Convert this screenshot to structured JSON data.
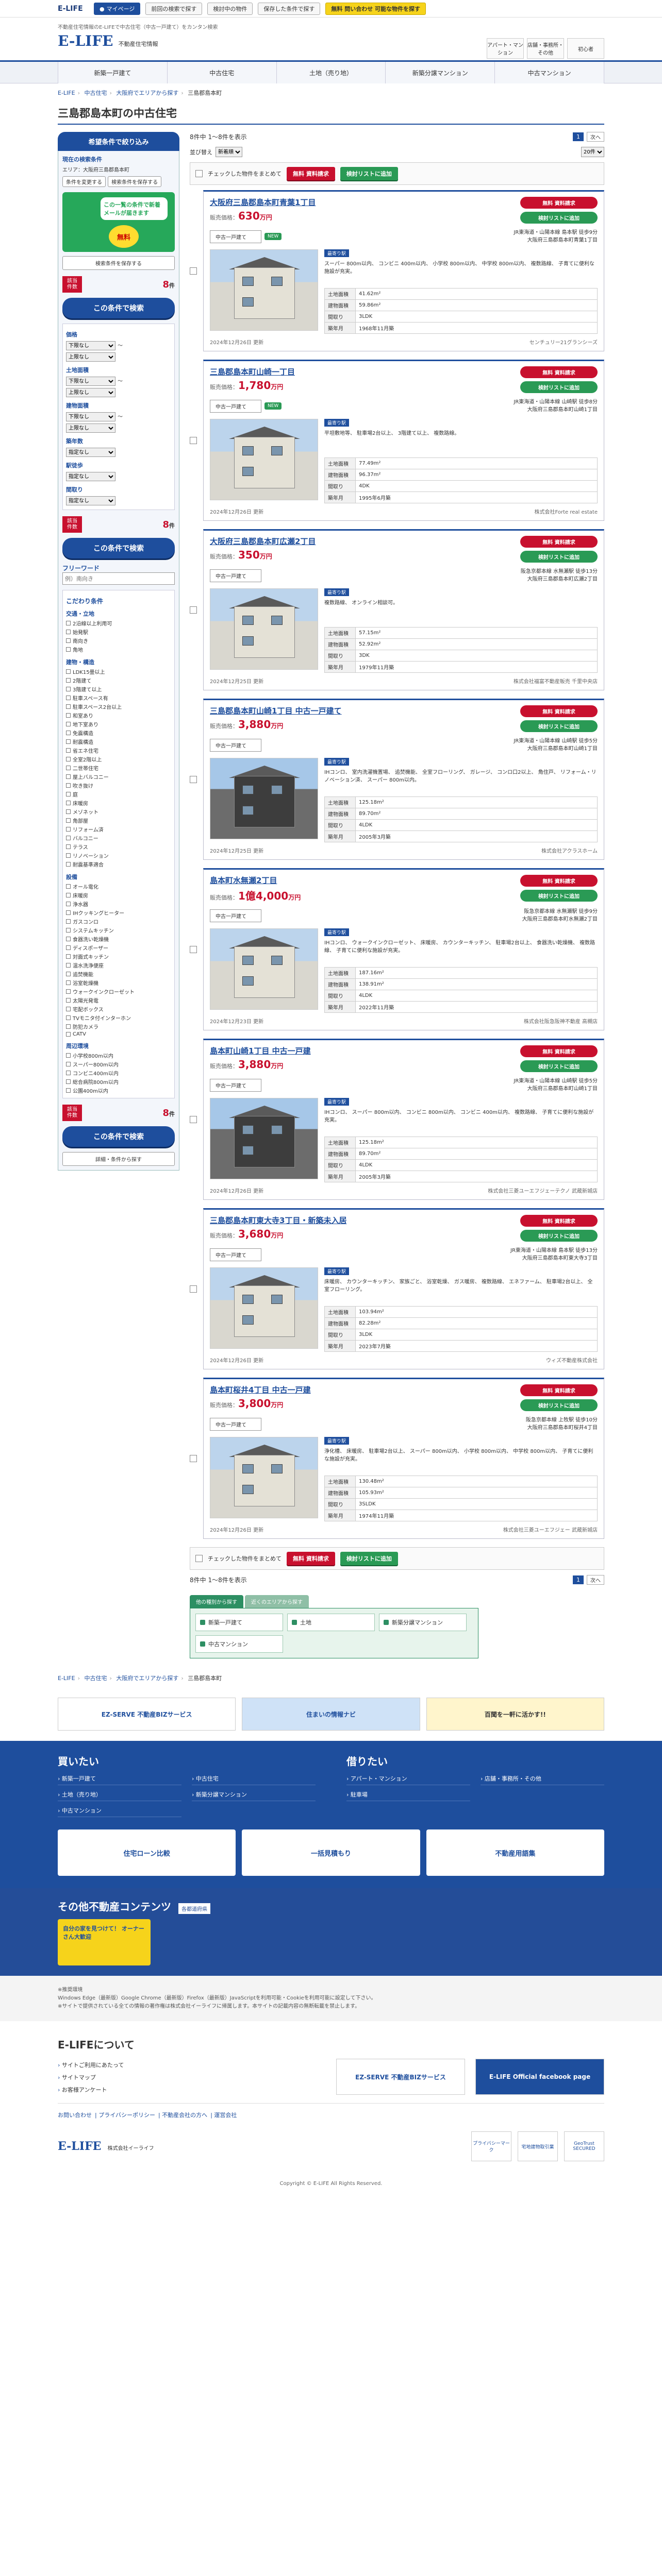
{
  "topbar": {
    "logo": "E-LIFE",
    "buttons": [
      "マイページ",
      "前回の検索で探す",
      "検討中の物件",
      "保存した条件で探す"
    ],
    "special": "無料 問い合わせ 可能な物件を探す"
  },
  "header": {
    "tagline": "不動産住宅情報のE-LIFEで中古住宅（中古一戸建て）をカンタン検索",
    "logo": "E-LIFE",
    "sub": "不動産住宅情報",
    "links": [
      "アパート・マンション",
      "店舗・事務所・その他",
      "初心者"
    ]
  },
  "gnav": [
    "新築一戸建て",
    "中古住宅",
    "土地（売り地）",
    "新築分譲マンション",
    "中古マンション"
  ],
  "breadcrumb": [
    "E-LIFE",
    "中古住宅",
    "大阪府でエリアから探す",
    "三島郡島本町"
  ],
  "page_title": "三島郡島本町の中古住宅",
  "sidebar": {
    "head": "希望条件で絞り込み",
    "cur_title": "現在の検索条件",
    "cur_area": "エリア：大阪府三島郡島本町",
    "cur_change": "条件を変更する",
    "save_btn": "検索条件を保存する",
    "promo_bubble": "この一覧の条件で新着メールが届きます",
    "promo_badge": "無料",
    "save_cond_btn": "検索条件を保存する",
    "hit_label": "該当件数",
    "hit_num": "8",
    "hit_unit": "件",
    "go_btn": "この条件で検索",
    "price_h": "価格",
    "select_low": "下限なし",
    "select_high": "上限なし",
    "tilde": "〜",
    "land_h": "土地面積",
    "build_h": "建物面積",
    "age_h": "築年数",
    "age_sel": "指定なし",
    "walk_h": "駅徒歩",
    "walk_sel": "指定なし",
    "madori_h": "間取り",
    "madori_sel": "指定なし",
    "free_h": "フリーワード",
    "free_ph": "例）南向き",
    "kodawari_h": "こだわり条件",
    "kodawari_sel": "指定なし",
    "groups": [
      {
        "title": "交通・立地",
        "items": [
          "2沿線以上利用可",
          "始発駅",
          "南向き",
          "角地"
        ]
      },
      {
        "title": "建物・構造",
        "items": [
          "LDK15畳以上",
          "2階建て",
          "3階建て以上",
          "駐車スペース有",
          "駐車スペース2台以上",
          "和室あり",
          "地下室あり",
          "免震構造",
          "耐震構造",
          "省エネ住宅",
          "全室2階以上",
          "二世帯住宅",
          "屋上バルコニー",
          "吹き抜け",
          "庭",
          "床暖房",
          "メゾネット",
          "角部屋",
          "リフォーム済",
          "バルコニー",
          "テラス",
          "リノベーション",
          "耐震基準適合"
        ]
      },
      {
        "title": "設備",
        "items": [
          "オール電化",
          "床暖房",
          "浄水器",
          "IHクッキングヒーター",
          "ガスコンロ",
          "システムキッチン",
          "食器洗い乾燥機",
          "ディスポーザー",
          "対面式キッチン",
          "温水洗浄便座",
          "追焚機能",
          "浴室乾燥機",
          "ウォークインクローゼット",
          "太陽光発電",
          "宅配ボックス",
          "TVモニタ付インターホン",
          "防犯カメラ",
          "CATV"
        ]
      },
      {
        "title": "周辺環境",
        "items": [
          "小学校800m以内",
          "スーパー800m以内",
          "コンビニ400m以内",
          "総合病院800m以内",
          "公園400m以内"
        ]
      }
    ],
    "bottom_btns": [
      "この条件で検索",
      "詳細・条件から探す"
    ]
  },
  "content": {
    "count_text": "8件中 1〜8件を表示",
    "pager_cur": "1",
    "pager_next": "次へ",
    "sort_label": "並び替え",
    "sort_val": "新着順",
    "per_page": "20件",
    "bulk_label": "チェックした物件をまとめて",
    "bulk_red": "無料 資料請求",
    "bulk_green": "検討リストに追加",
    "price_prefix": "販売価格："
  },
  "listings": [
    {
      "title": "大阪府三島郡島本町青葉1丁目",
      "price": "630",
      "unit": "万円",
      "type": "中古一戸建て",
      "new": "NEW",
      "line": "JR東海道・山陽本線 島本駅 徒歩9分",
      "addr": "大阪府三島郡島本町青葉1丁目",
      "desc": "スーパー 800m以内、 コンビニ 400m以内、 小学校 800m以内、 中学校 800m以内、 複数路線、 子育てに便利な施設が充実。",
      "land": "41.62m²",
      "build": "59.86m²",
      "madori": "3LDK",
      "age": "1968年11月築",
      "date": "2024年12月26日 更新",
      "co": "センチュリー21グランシーズ",
      "dark": false
    },
    {
      "title": "三島郡島本町山崎一丁目",
      "price": "1,780",
      "unit": "万円",
      "type": "中古一戸建て",
      "new": "NEW",
      "line": "JR東海道・山陽本線 山崎駅 徒歩8分",
      "addr": "大阪府三島郡島本町山崎1丁目",
      "desc": "平坦敷地等、 駐車場2台以上、 3階建て以上、 複数路線。",
      "land": "77.49m²",
      "build": "96.37m²",
      "madori": "4DK",
      "age": "1995年6月築",
      "date": "2024年12月26日 更新",
      "co": "株式会社Forte real estate",
      "dark": false
    },
    {
      "title": "大阪府三島郡島本町広瀬2丁目",
      "price": "350",
      "unit": "万円",
      "type": "中古一戸建て",
      "new": "",
      "line": "阪急京都本線 水無瀬駅 徒歩13分",
      "addr": "大阪府三島郡島本町広瀬2丁目",
      "desc": "複数路線、 オンライン相談可。",
      "land": "57.15m²",
      "build": "52.92m²",
      "madori": "3DK",
      "age": "1979年11月築",
      "date": "2024年12月25日 更新",
      "co": "株式会社福富不動産販売 千里中央店",
      "dark": false
    },
    {
      "title": "三島郡島本町山崎1丁目 中古一戸建て",
      "price": "3,880",
      "unit": "万円",
      "type": "中古一戸建て",
      "new": "",
      "line": "JR東海道・山陽本線 山崎駅 徒歩5分",
      "addr": "大阪府三島郡島本町山崎1丁目",
      "desc": "IHコンロ、 室内洗濯機置場、 追焚機能、 全室フローリング、 ガレージ、 コンロ口2以上、 角住戸、 リフォーム・リノベーション済、 スーパー 800m以内。",
      "land": "125.18m²",
      "build": "89.70m²",
      "madori": "4LDK",
      "age": "2005年3月築",
      "date": "2024年12月25日 更新",
      "co": "株式会社アクラスホーム",
      "dark": true
    },
    {
      "title": "島本町水無瀬2丁目",
      "price": "1億4,000",
      "unit": "万円",
      "type": "中古一戸建て",
      "new": "",
      "line": "阪急京都本線 水無瀬駅 徒歩9分",
      "addr": "大阪府三島郡島本町水無瀬2丁目",
      "desc": "IHコンロ、 ウォークインクローゼット、 床暖房、 カウンターキッチン、 駐車場2台以上、 食器洗い乾燥機、 複数路線、 子育てに便利な施設が充実。",
      "land": "187.16m²",
      "build": "138.91m²",
      "madori": "4LDK",
      "age": "2022年11月築",
      "date": "2024年12月23日 更新",
      "co": "株式会社阪急阪神不動産 高槻店",
      "dark": false
    },
    {
      "title": "島本町山崎1丁目 中古一戸建",
      "price": "3,880",
      "unit": "万円",
      "type": "中古一戸建て",
      "new": "",
      "line": "JR東海道・山陽本線 山崎駅 徒歩5分",
      "addr": "大阪府三島郡島本町山崎1丁目",
      "desc": "IHコンロ、 スーパー 800m以内、 コンビニ 800m以内、 コンビニ 400m以内、 複数路線、 子育てに便利な施設が充実。",
      "land": "125.18m²",
      "build": "89.70m²",
      "madori": "4LDK",
      "age": "2005年3月築",
      "date": "2024年12月26日 更新",
      "co": "株式会社三菱ユーエフジェーテクノ 武蔵新城店",
      "dark": true
    },
    {
      "title": "三島郡島本町東大寺3丁目・新築未入居",
      "price": "3,680",
      "unit": "万円",
      "type": "中古一戸建て",
      "new": "",
      "line": "JR東海道・山陽本線 島本駅 徒歩13分",
      "addr": "大阪府三島郡島本町東大寺3丁目",
      "desc": "床暖房、 カウンターキッチン、 家族ごと、 浴室乾燥、 ガス暖房、 複数路線、 エネファーム、 駐車場2台以上、 全室フローリング。",
      "land": "103.94m²",
      "build": "82.28m²",
      "madori": "3LDK",
      "age": "2023年7月築",
      "date": "2024年12月26日 更新",
      "co": "ウィズ不動産株式会社",
      "dark": false
    },
    {
      "title": "島本町桜井4丁目 中古一戸建",
      "price": "3,800",
      "unit": "万円",
      "type": "中古一戸建て",
      "new": "",
      "line": "阪急京都本線 上牧駅 徒歩10分",
      "addr": "大阪府三島郡島本町桜井4丁目",
      "desc": "浄化槽、 床暖房、 駐車場2台以上、 スーパー 800m以内、 小学校 800m以内、 中学校 800m以内、 子育てに便利な施設が充実。",
      "land": "130.48m²",
      "build": "105.93m²",
      "madori": "3SLDK",
      "age": "1974年11月築",
      "date": "2024年12月26日 更新",
      "co": "株式会社三菱ユーエフジェー 武蔵新城店",
      "dark": false
    }
  ],
  "labels": {
    "land": "土地面積",
    "build": "建物面積",
    "madori": "間取り",
    "age": "築年月",
    "request": "無料 資料請求",
    "addlist": "検討リストに追加",
    "type_badge": "最寄り駅"
  },
  "tabsbox": {
    "tabs": [
      "他の種別から探す",
      "近くのエリアから探す"
    ],
    "items": [
      "新築一戸建て",
      "土地",
      "新築分譲マンション",
      "中古マンション"
    ]
  },
  "banners": [
    "EZ-SERVE 不動産BIZサービス",
    "住まいの情報ナビ",
    "百聞を一軒に活かす!!"
  ],
  "footnav": {
    "buy": {
      "title": "買いたい",
      "links": [
        "新築一戸建て",
        "中古住宅",
        "土地（売り地）",
        "新築分譲マンション",
        "中古マンション"
      ]
    },
    "rent": {
      "title": "借りたい",
      "links": [
        "アパート・マンション",
        "店舗・事務所・その他",
        "駐車場"
      ]
    },
    "banners": [
      "住宅ローン比較",
      "一括見積もり",
      "不動産用語集"
    ]
  },
  "other": {
    "title": "その他不動産コンテンツ",
    "tag": "各都道府県",
    "card": "自分の家を見つけて！ オーナーさん大歓迎"
  },
  "notes": [
    "※推奨環境",
    "Windows Edge（最新版）Google Chrome（最新版）Firefox（最新版）JavaScriptを利用可能・Cookieを利用可能に設定して下さい。",
    "※サイトで提供されている全ての情報の著作権は株式会社イーライフに帰属します。本サイトの記載内容の無断転載を禁止します。"
  ],
  "about": {
    "title": "E-LIFEについて",
    "links": [
      "サイトご利用にあたって",
      "サイトマップ",
      "お客様アンケート"
    ],
    "banners": [
      "EZ-SERVE 不動産BIZサービス",
      "E-LIFE Official facebook page"
    ]
  },
  "bottomlinks": [
    "お問い合わせ",
    "プライバシーポリシー",
    "不動産会社の方へ",
    "運営会社"
  ],
  "copy": {
    "logo": "E-LIFE",
    "sub": "株式会社イーライフ",
    "seals": [
      "プライバシーマーク",
      "宅地建物取引業",
      "GeoTrust SECURED"
    ],
    "copyright": "Copyright © E-LIFE All Rights Reserved."
  }
}
